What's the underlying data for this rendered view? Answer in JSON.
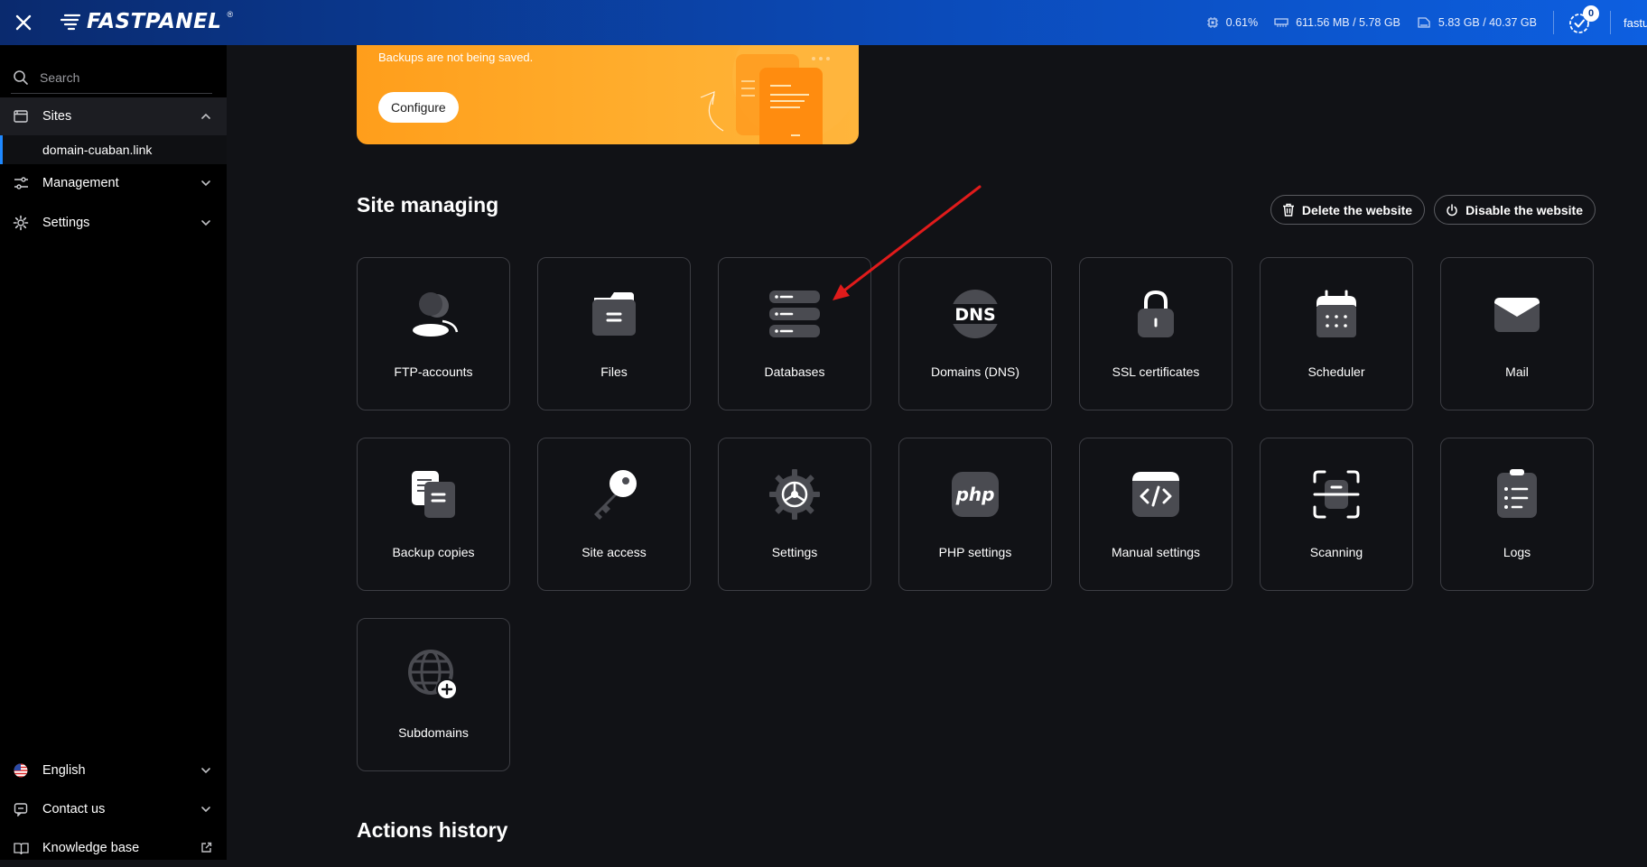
{
  "topbar": {
    "logo_text": "FASTPANEL",
    "logo_reg": "®",
    "stats": [
      {
        "icon": "cpu-icon",
        "value": "0.61%"
      },
      {
        "icon": "memory-icon",
        "value": "611.56 MB / 5.78 GB"
      },
      {
        "icon": "disk-icon",
        "value": "5.83 GB / 40.37 GB"
      }
    ],
    "notifications_count": "0",
    "user": "fastu"
  },
  "sidebar": {
    "search_placeholder": "Search",
    "sites_label": "Sites",
    "current_site": "domain-cuaban.link",
    "management_label": "Management",
    "settings_label": "Settings",
    "language_label": "English",
    "contact_label": "Contact us",
    "kb_label": "Knowledge base"
  },
  "banner": {
    "text": "Backups are not being saved.",
    "button": "Configure"
  },
  "site_managing": {
    "title": "Site managing",
    "delete_btn": "Delete the website",
    "disable_btn": "Disable the website",
    "tiles": [
      {
        "label": "FTP-accounts",
        "icon": "ftp-users-icon"
      },
      {
        "label": "Files",
        "icon": "folder-icon"
      },
      {
        "label": "Databases",
        "icon": "database-icon"
      },
      {
        "label": "Domains (DNS)",
        "icon": "dns-icon"
      },
      {
        "label": "SSL certificates",
        "icon": "lock-icon"
      },
      {
        "label": "Scheduler",
        "icon": "calendar-icon"
      },
      {
        "label": "Mail",
        "icon": "mail-icon"
      },
      {
        "label": "Backup copies",
        "icon": "backup-icon"
      },
      {
        "label": "Site access",
        "icon": "key-icon"
      },
      {
        "label": "Settings",
        "icon": "gear-icon"
      },
      {
        "label": "PHP settings",
        "icon": "php-icon"
      },
      {
        "label": "Manual settings",
        "icon": "code-icon"
      },
      {
        "label": "Scanning",
        "icon": "scan-icon"
      },
      {
        "label": "Logs",
        "icon": "logs-icon"
      },
      {
        "label": "Subdomains",
        "icon": "globe-plus-icon"
      }
    ]
  },
  "actions_history": {
    "title": "Actions history"
  },
  "colors": {
    "topbar_start": "#0a2a6e",
    "topbar_end": "#0d5fe0",
    "banner": "#ffa623",
    "accent": "#1e88ff",
    "annotation_arrow": "#e01b1b"
  }
}
